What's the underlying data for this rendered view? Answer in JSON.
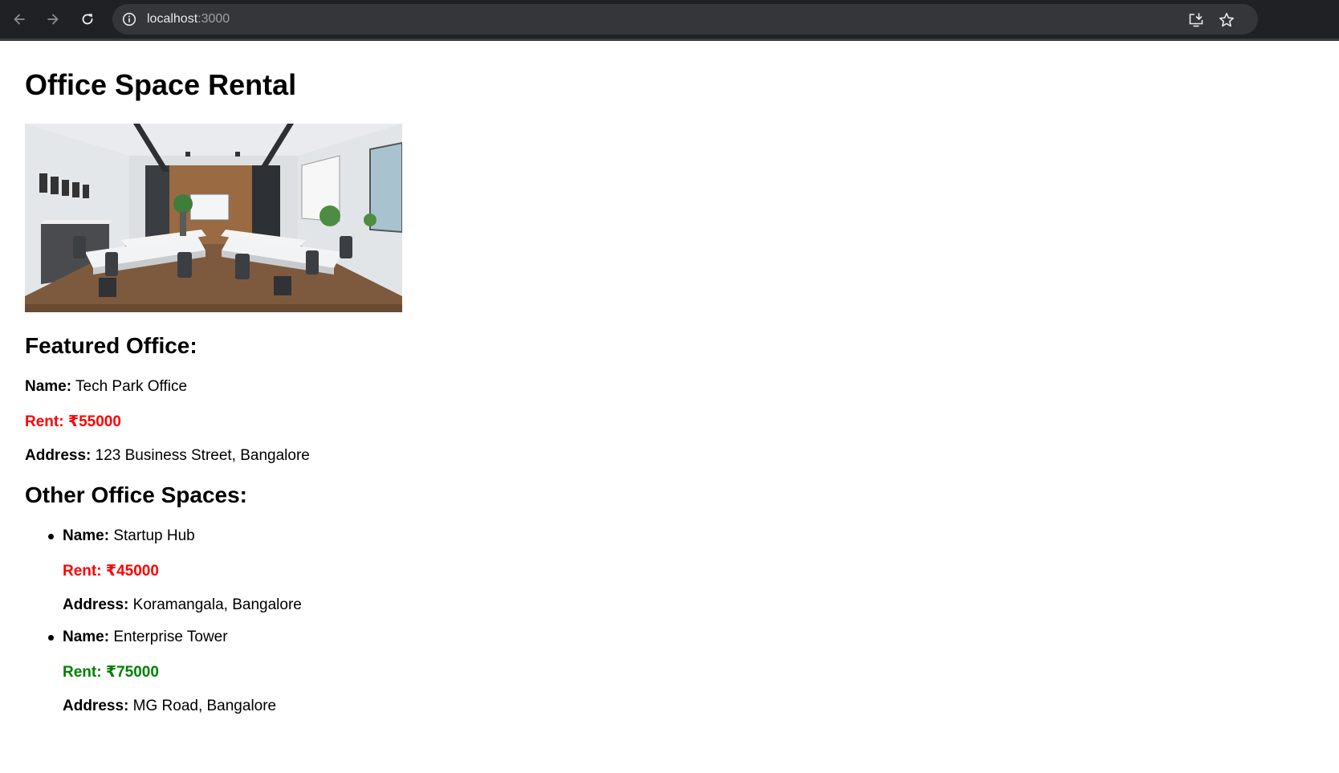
{
  "browser": {
    "url_host": "localhost",
    "url_port": ":3000"
  },
  "page": {
    "title": "Office Space Rental",
    "featured_heading": "Featured Office:",
    "featured": {
      "name_label": "Name:",
      "name": "Tech Park Office",
      "rent_label": "Rent:",
      "rent": "₹55000",
      "rent_color": "#ff0000",
      "address_label": "Address:",
      "address": "123 Business Street, Bangalore"
    },
    "others_heading": "Other Office Spaces:",
    "others": [
      {
        "name_label": "Name:",
        "name": "Startup Hub",
        "rent_label": "Rent:",
        "rent": "₹45000",
        "rent_color": "#ff0000",
        "address_label": "Address:",
        "address": "Koramangala, Bangalore"
      },
      {
        "name_label": "Name:",
        "name": "Enterprise Tower",
        "rent_label": "Rent:",
        "rent": "₹75000",
        "rent_color": "#008000",
        "address_label": "Address:",
        "address": "MG Road, Bangalore"
      }
    ]
  }
}
